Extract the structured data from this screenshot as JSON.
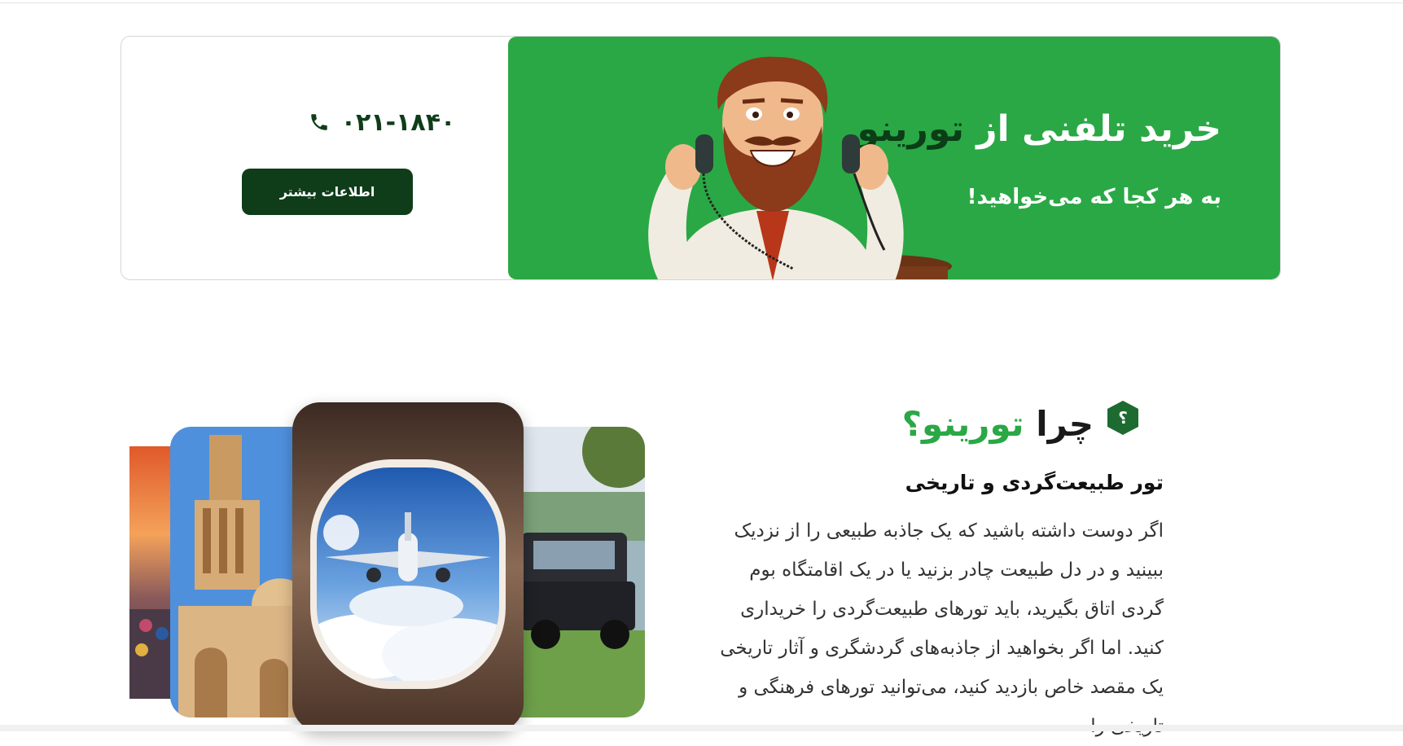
{
  "banner": {
    "title_prefix": "خرید تلفنی از",
    "title_brand": "تورینو",
    "subtitle": "به هر کجا که می‌خواهید!",
    "phone": "۰۲۱-۱۸۴۰",
    "more_label": "اطلاعات بیشتر",
    "colors": {
      "green": "#2aa845",
      "dark_green": "#0f3d1a"
    }
  },
  "why": {
    "badge": "؟",
    "heading_prefix": "چرا",
    "heading_brand": "تورینو؟",
    "subheading": "تور طبیعت‌گردی و تاریخی",
    "paragraph": "اگر دوست داشته باشید که یک جاذبه طبیعی را از نزدیک ببینید و در دل طبیعت چادر بزنید یا در یک اقامتگاه بوم گردی اتاق بگیرید، باید تورهای طبیعت‌گردی را خریداری کنید. اما اگر بخواهید از جاذبه‌های گردشگری و آثار تاریخی یک مقصد خاص بازدید کنید، می‌توانید تورهای فرهنگی و تاریخی را"
  },
  "gallery": {
    "images": [
      "sunset-beach",
      "yazd-windcatcher",
      "airplane-window",
      "suv-by-lake"
    ]
  }
}
